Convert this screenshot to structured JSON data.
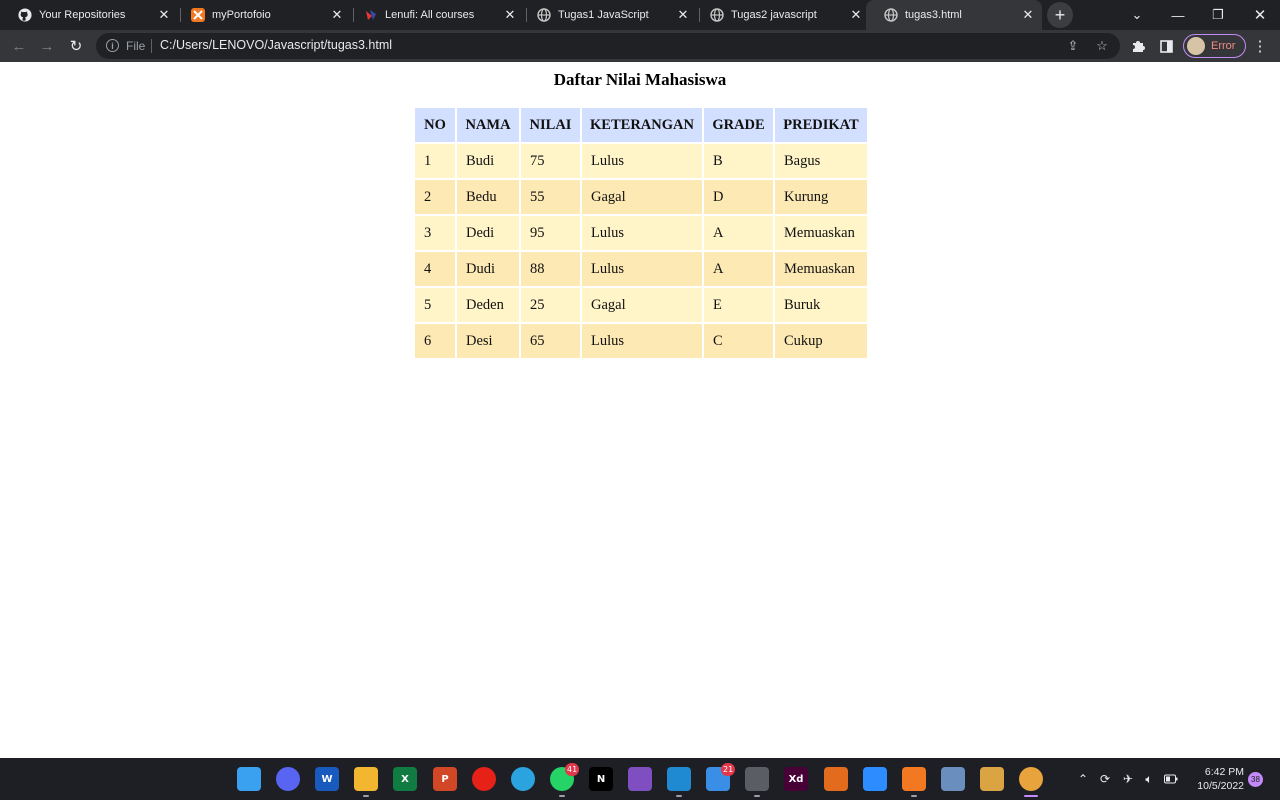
{
  "browser": {
    "tabs": [
      {
        "title": "Your Repositories",
        "icon": "github-icon"
      },
      {
        "title": "myPortofoio",
        "icon": "xampp-icon"
      },
      {
        "title": "Lenufi: All courses",
        "icon": "lenufi-icon"
      },
      {
        "title": "Tugas1 JavaScript",
        "icon": "globe-icon"
      },
      {
        "title": "Tugas2 javascript",
        "icon": "globe-icon"
      },
      {
        "title": "tugas3.html",
        "icon": "globe-icon",
        "active": true
      }
    ],
    "address": {
      "scheme_label": "File",
      "url": "C:/Users/LENOVO/Javascript/tugas3.html"
    },
    "profile_status": "Error"
  },
  "page": {
    "title": "Daftar Nilai Mahasiswa",
    "table": {
      "headers": [
        "NO",
        "NAMA",
        "NILAI",
        "KETERANGAN",
        "GRADE",
        "PREDIKAT"
      ],
      "rows": [
        [
          "1",
          "Budi",
          "75",
          "Lulus",
          "B",
          "Bagus"
        ],
        [
          "2",
          "Bedu",
          "55",
          "Gagal",
          "D",
          "Kurung"
        ],
        [
          "3",
          "Dedi",
          "95",
          "Lulus",
          "A",
          "Memuaskan"
        ],
        [
          "4",
          "Dudi",
          "88",
          "Lulus",
          "A",
          "Memuaskan"
        ],
        [
          "5",
          "Deden",
          "25",
          "Gagal",
          "E",
          "Buruk"
        ],
        [
          "6",
          "Desi",
          "65",
          "Lulus",
          "C",
          "Cukup"
        ]
      ]
    }
  },
  "taskbar": {
    "apps": [
      {
        "name": "windows-start-icon",
        "label": "",
        "color": "#3aa0f0"
      },
      {
        "name": "discord-icon",
        "label": "",
        "color": "#5865f2"
      },
      {
        "name": "word-icon",
        "label": "W",
        "color": "#185abd"
      },
      {
        "name": "file-explorer-icon",
        "label": "",
        "color": "#f2b630"
      },
      {
        "name": "excel-icon",
        "label": "X",
        "color": "#107c41"
      },
      {
        "name": "powerpoint-icon",
        "label": "P",
        "color": "#d24726"
      },
      {
        "name": "youtube-music-icon",
        "label": "",
        "color": "#e62117"
      },
      {
        "name": "telegram-icon",
        "label": "",
        "color": "#2aa3df"
      },
      {
        "name": "whatsapp-icon",
        "label": "",
        "color": "#25d366",
        "badge": "41"
      },
      {
        "name": "netflix-icon",
        "label": "N",
        "color": "#000000"
      },
      {
        "name": "visual-studio-icon",
        "label": "",
        "color": "#7f4fc1"
      },
      {
        "name": "vscode-icon",
        "label": "",
        "color": "#1f8ad2"
      },
      {
        "name": "mail-icon",
        "label": "",
        "color": "#3a8ee6",
        "badge": "21"
      },
      {
        "name": "snipping-tool-icon",
        "label": "",
        "color": "#5a5d63"
      },
      {
        "name": "adobe-xd-icon",
        "label": "Xd",
        "color": "#470137"
      },
      {
        "name": "matlab-icon",
        "label": "",
        "color": "#e26b1d"
      },
      {
        "name": "zoom-icon",
        "label": "",
        "color": "#2d8cff"
      },
      {
        "name": "xampp-icon",
        "label": "",
        "color": "#f37822"
      },
      {
        "name": "virtualbox-icon",
        "label": "",
        "color": "#6a8fbf"
      },
      {
        "name": "git-tool-icon",
        "label": "",
        "color": "#d9a441"
      },
      {
        "name": "chrome-icon",
        "label": "",
        "color": "#e8a33c"
      }
    ],
    "clock_time": "6:42 PM",
    "clock_date": "10/5/2022",
    "notification_count": "38"
  }
}
